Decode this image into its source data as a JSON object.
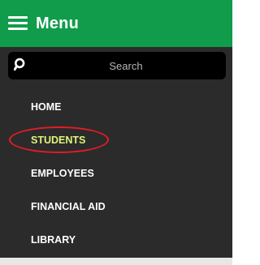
{
  "menu": {
    "title": "Menu",
    "icon": "hamburger-icon"
  },
  "search": {
    "placeholder": "Search",
    "icon": "search-icon"
  },
  "nav": {
    "items": [
      {
        "label": "HOME",
        "active": false
      },
      {
        "label": "STUDENTS",
        "active": true
      },
      {
        "label": "EMPLOYEES",
        "active": false
      },
      {
        "label": "FINANCIAL AID",
        "active": false
      },
      {
        "label": "LIBRARY",
        "active": false
      }
    ]
  },
  "colors": {
    "header_bg": "#119c4b",
    "panel_bg": "#2b2b2b",
    "active_text": "#e2f27a",
    "annotation_circle": "#e11d25"
  }
}
